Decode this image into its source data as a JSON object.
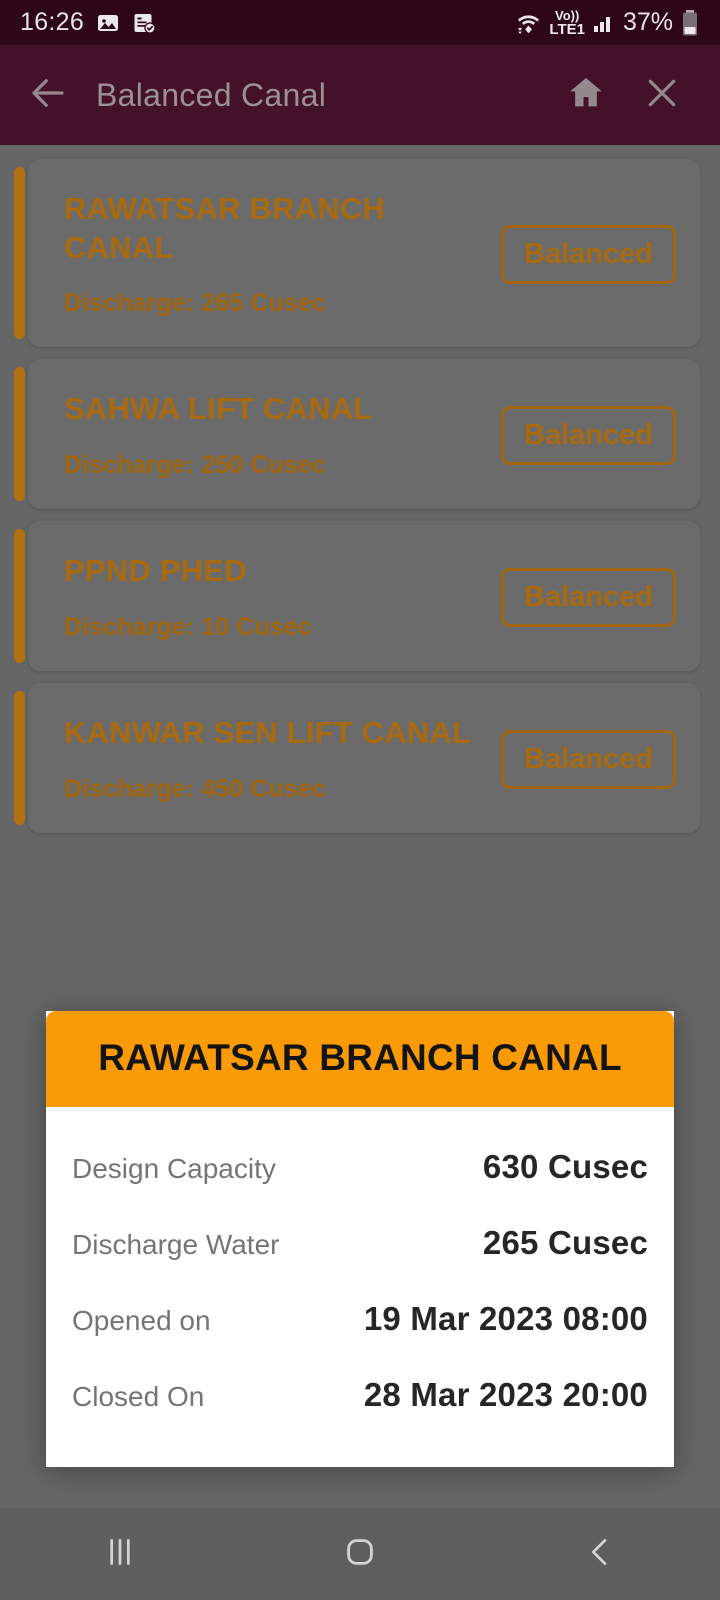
{
  "status_bar": {
    "time": "16:26",
    "notification_icons": [
      "image-icon",
      "document-check-icon"
    ],
    "wifi_icon": "wifi-icon",
    "volte_label_top": "Vo))",
    "volte_label_bottom": "LTE1",
    "signal_icon": "signal-bars-icon",
    "battery_percent": "37%",
    "battery_icon": "battery-icon"
  },
  "app_bar": {
    "back_icon": "back-arrow-icon",
    "title": "Balanced Canal",
    "home_icon": "home-icon",
    "close_icon": "close-icon"
  },
  "colors": {
    "accent_orange": "#fa9a05",
    "card_text_orange": "#a86a10",
    "appbar_maroon": "#43112a",
    "statusbar_maroon": "#2d0718",
    "scrim_gray": "#666666"
  },
  "canal_list": [
    {
      "name": "RAWATSAR BRANCH CANAL",
      "discharge": "Discharge: 265 Cusec",
      "status": "Balanced"
    },
    {
      "name": "SAHWA LIFT CANAL",
      "discharge": "Discharge: 250 Cusec",
      "status": "Balanced"
    },
    {
      "name": "PPND PHED",
      "discharge": "Discharge: 10 Cusec",
      "status": "Balanced"
    },
    {
      "name": "KANWAR SEN LIFT CANAL",
      "discharge": "Discharge: 450 Cusec",
      "status": "Balanced"
    }
  ],
  "dialog": {
    "title": "RAWATSAR BRANCH CANAL",
    "rows": [
      {
        "label": "Design Capacity",
        "value": "630 Cusec"
      },
      {
        "label": "Discharge Water",
        "value": "265 Cusec"
      },
      {
        "label": "Opened on",
        "value": "19 Mar 2023 08:00"
      },
      {
        "label": "Closed On",
        "value": "28 Mar 2023 20:00"
      }
    ]
  },
  "nav_bar": {
    "recents_icon": "recents-icon",
    "home_icon": "home-square-icon",
    "back_icon": "back-chevron-icon"
  }
}
